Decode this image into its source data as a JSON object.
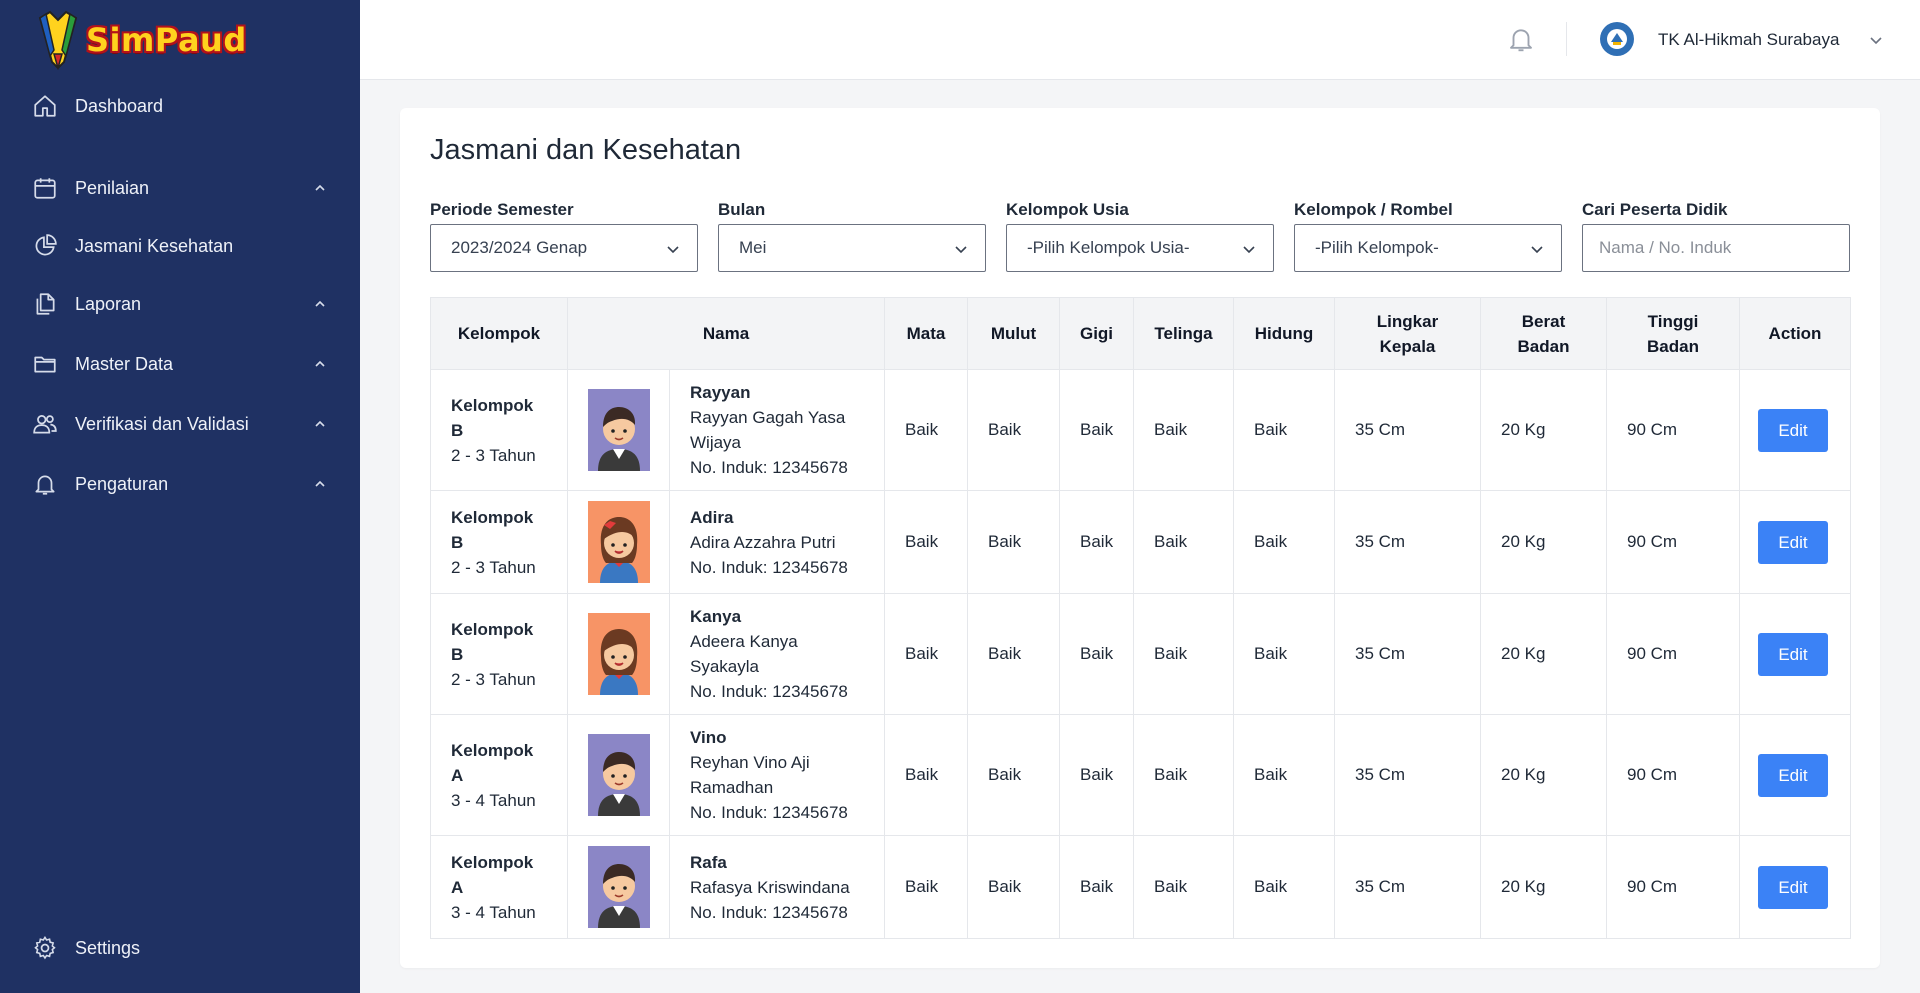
{
  "app": {
    "name": "SimPaud"
  },
  "colors": {
    "sidebar_bg": "#1f3163",
    "accent": "#3b82f6",
    "logo_text": "#ffd21e"
  },
  "sidebar": {
    "items": [
      {
        "label": "Dashboard",
        "icon": "home-icon",
        "expandable": false
      },
      {
        "label": "Penilaian",
        "icon": "calendar-icon",
        "expandable": true
      },
      {
        "label": "Jasmani Kesehatan",
        "icon": "pie-chart-icon",
        "expandable": false
      },
      {
        "label": "Laporan",
        "icon": "documents-icon",
        "expandable": true
      },
      {
        "label": "Master Data",
        "icon": "folder-icon",
        "expandable": true
      },
      {
        "label": "Verifikasi dan Validasi",
        "icon": "users-icon",
        "expandable": true
      },
      {
        "label": "Pengaturan",
        "icon": "bell-icon",
        "expandable": true
      }
    ],
    "settings_label": "Settings"
  },
  "header": {
    "school_name": "TK Al-Hikmah Surabaya"
  },
  "page": {
    "title": "Jasmani dan Kesehatan"
  },
  "filters": {
    "periode": {
      "label": "Periode Semester",
      "value": "2023/2024 Genap"
    },
    "bulan": {
      "label": "Bulan",
      "value": "Mei"
    },
    "kelompok_usia": {
      "label": "Kelompok Usia",
      "value": "-Pilih Kelompok Usia-"
    },
    "rombel": {
      "label": "Kelompok / Rombel",
      "value": "-Pilih Kelompok-"
    },
    "search": {
      "label": "Cari Peserta Didik",
      "placeholder": "Nama / No. Induk"
    }
  },
  "table": {
    "headers": {
      "kelompok": "Kelompok",
      "nama": "Nama",
      "mata": "Mata",
      "mulut": "Mulut",
      "gigi": "Gigi",
      "telinga": "Telinga",
      "hidung": "Hidung",
      "lingkar_1": "Lingkar",
      "lingkar_2": "Kepala",
      "berat_1": "Berat",
      "berat_2": "Badan",
      "tinggi_1": "Tinggi",
      "tinggi_2": "Badan",
      "action": "Action"
    },
    "rows": [
      {
        "kel1": "Kelompok",
        "kel2": "B",
        "usia": "2 - 3 Tahun",
        "avatar": "boy",
        "nick": "Rayyan",
        "full1": "Rayyan Gagah Yasa",
        "full2": "Wijaya",
        "induk": "No. Induk: 12345678",
        "mata": "Baik",
        "mulut": "Baik",
        "gigi": "Baik",
        "telinga": "Baik",
        "hidung": "Baik",
        "lingkar": "35 Cm",
        "berat": "20 Kg",
        "tinggi": "90 Cm",
        "action": "Edit"
      },
      {
        "kel1": "Kelompok",
        "kel2": "B",
        "usia": "2 - 3 Tahun",
        "avatar": "girl",
        "nick": "Adira",
        "full1": "Adira Azzahra Putri",
        "full2": "",
        "induk": "No. Induk: 12345678",
        "mata": "Baik",
        "mulut": "Baik",
        "gigi": "Baik",
        "telinga": "Baik",
        "hidung": "Baik",
        "lingkar": "35 Cm",
        "berat": "20 Kg",
        "tinggi": "90 Cm",
        "action": "Edit"
      },
      {
        "kel1": "Kelompok",
        "kel2": "B",
        "usia": "2 - 3 Tahun",
        "avatar": "girl",
        "nick": "Kanya",
        "full1": "Adeera Kanya",
        "full2": "Syakayla",
        "induk": "No. Induk: 12345678",
        "mata": "Baik",
        "mulut": "Baik",
        "gigi": "Baik",
        "telinga": "Baik",
        "hidung": "Baik",
        "lingkar": "35 Cm",
        "berat": "20 Kg",
        "tinggi": "90 Cm",
        "action": "Edit"
      },
      {
        "kel1": "Kelompok",
        "kel2": "A",
        "usia": "3 - 4 Tahun",
        "avatar": "boy",
        "nick": "Vino",
        "full1": "Reyhan Vino Aji",
        "full2": "Ramadhan",
        "induk": "No. Induk: 12345678",
        "mata": "Baik",
        "mulut": "Baik",
        "gigi": "Baik",
        "telinga": "Baik",
        "hidung": "Baik",
        "lingkar": "35 Cm",
        "berat": "20 Kg",
        "tinggi": "90 Cm",
        "action": "Edit"
      },
      {
        "kel1": "Kelompok",
        "kel2": "A",
        "usia": "3 - 4 Tahun",
        "avatar": "boy",
        "nick": "Rafa",
        "full1": "Rafasya Kriswindana",
        "full2": "",
        "induk": "No. Induk: 12345678",
        "mata": "Baik",
        "mulut": "Baik",
        "gigi": "Baik",
        "telinga": "Baik",
        "hidung": "Baik",
        "lingkar": "35 Cm",
        "berat": "20 Kg",
        "tinggi": "90 Cm",
        "action": "Edit"
      }
    ]
  }
}
